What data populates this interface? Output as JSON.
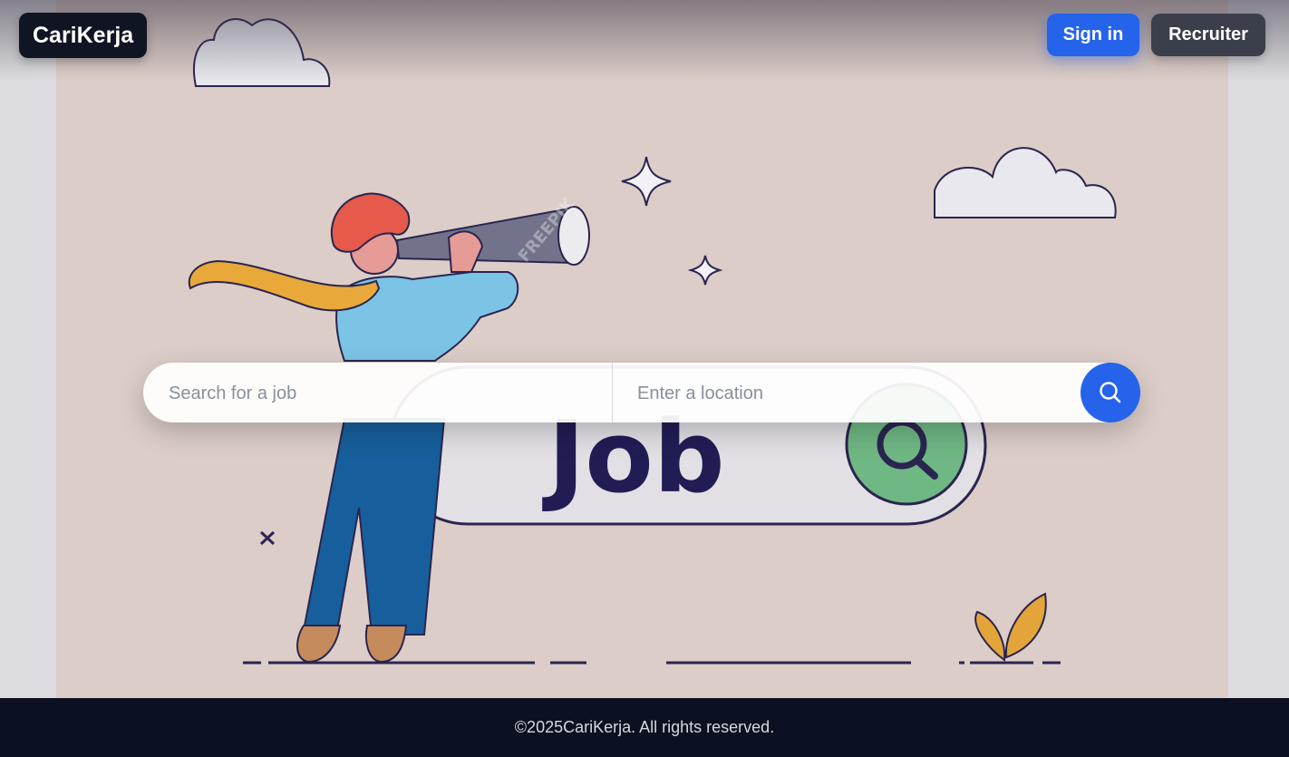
{
  "header": {
    "logo_text": "CariKerja",
    "signin_label": "Sign in",
    "recruiter_label": "Recruiter"
  },
  "hero": {
    "illustration_text": "Job",
    "illustration_watermark": "FREEPIK"
  },
  "search": {
    "job_placeholder": "Search for a job",
    "location_placeholder": "Enter a location",
    "button_icon": "search-icon"
  },
  "footer": {
    "copyright": "©2025CariKerja. All rights reserved."
  },
  "colors": {
    "primary": "#2563eb",
    "dark": "#0f1522",
    "hero_bg": "#dccdc8"
  }
}
